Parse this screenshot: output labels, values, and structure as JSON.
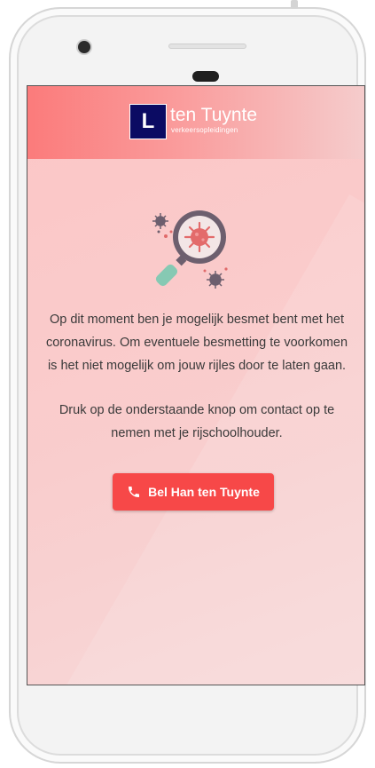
{
  "header": {
    "logo_letter": "L",
    "brand_name": "ten Tuynte",
    "brand_tagline": "verkeersopleidingen"
  },
  "illustration": {
    "icon": "virus-magnifier-icon"
  },
  "message": {
    "paragraph1": "Op dit moment ben je mogelijk besmet bent met het coronavirus. Om eventuele besmetting te voorkomen is het niet mogelijk om jouw rijles door te laten gaan.",
    "paragraph2": "Druk op de onderstaande knop om contact op te nemen met je rijschoolhouder."
  },
  "call_button": {
    "label": "Bel Han ten Tuynte",
    "icon": "phone-icon"
  },
  "colors": {
    "accent": "#f74848",
    "logo_bg": "#0b0b63",
    "header_start": "#fb7b7b",
    "background": "#fcc6c6"
  }
}
